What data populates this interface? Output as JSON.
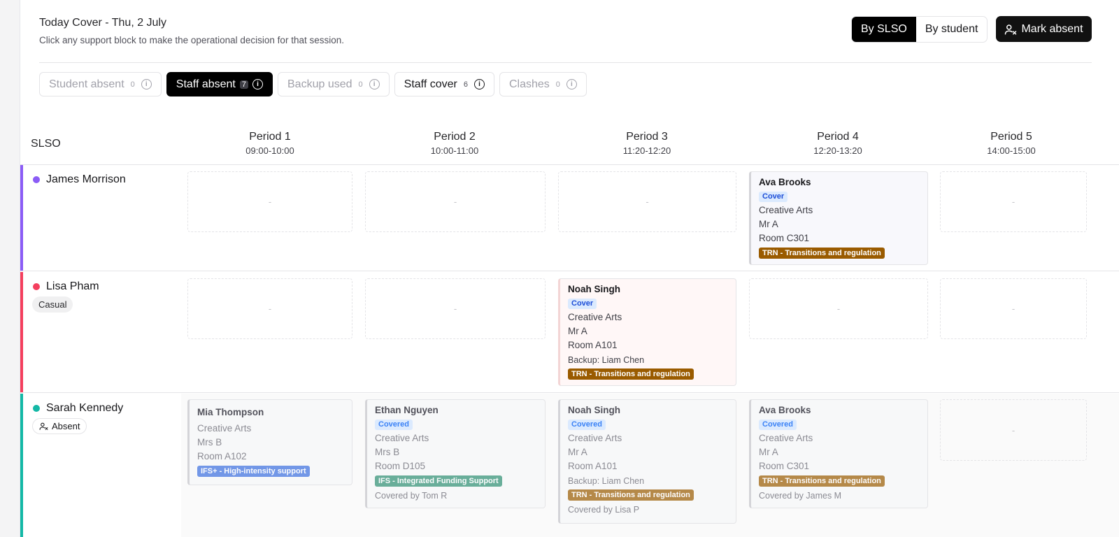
{
  "header": {
    "title": "Today Cover - Thu, 2 July",
    "subtitle": "Click any support block to make the operational decision for that session."
  },
  "view_toggle": {
    "by_slso": "By SLSO",
    "by_student": "By student",
    "active": "By SLSO"
  },
  "mark_absent_label": "Mark absent",
  "filters": [
    {
      "label": "Student absent",
      "count": "0",
      "state": "muted"
    },
    {
      "label": "Staff absent",
      "count": "7",
      "state": "active"
    },
    {
      "label": "Backup used",
      "count": "0",
      "state": "muted"
    },
    {
      "label": "Staff cover",
      "count": "6",
      "state": "strong"
    },
    {
      "label": "Clashes",
      "count": "0",
      "state": "muted"
    }
  ],
  "grid": {
    "slso_header": "SLSO",
    "periods": [
      {
        "name": "Period 1",
        "time": "09:00-10:00"
      },
      {
        "name": "Period 2",
        "time": "10:00-11:00"
      },
      {
        "name": "Period 3",
        "time": "11:20-12:20"
      },
      {
        "name": "Period 4",
        "time": "12:20-13:20"
      },
      {
        "name": "Period 5",
        "time": "14:00-15:00"
      }
    ],
    "empty_mark": "-",
    "rows": [
      {
        "name": "James Morrison",
        "color": "#8b5cf6",
        "tag": "",
        "cells": [
          null,
          null,
          null,
          {
            "student": "Ava Brooks",
            "status": "Cover",
            "subject": "Creative Arts",
            "teacher": "Mr A",
            "room": "Room C301",
            "backup": "",
            "support": "TRN - Transitions and regulation",
            "support_color": "#9a5b00",
            "covered_by": ""
          },
          null
        ]
      },
      {
        "name": "Lisa Pham",
        "color": "#f43f5e",
        "tag": "Casual",
        "cells": [
          null,
          null,
          {
            "student": "Noah Singh",
            "status": "Cover",
            "subject": "Creative Arts",
            "teacher": "Mr A",
            "room": "Room A101",
            "backup": "Backup: Liam Chen",
            "support": "TRN - Transitions and regulation",
            "support_color": "#9a5b00",
            "covered_by": ""
          },
          null,
          null
        ]
      },
      {
        "name": "Sarah Kennedy",
        "color": "#14b8a6",
        "tag": "Absent",
        "cells": [
          {
            "student": "Mia Thompson",
            "status": "",
            "subject": "Creative Arts",
            "teacher": "Mrs B",
            "room": "Room A102",
            "backup": "",
            "support": "IFS+ - High-intensity support",
            "support_color": "#3b6fe0",
            "covered_by": ""
          },
          {
            "student": "Ethan Nguyen",
            "status": "Covered",
            "subject": "Creative Arts",
            "teacher": "Mrs B",
            "room": "Room D105",
            "backup": "",
            "support": "IFS - Integrated Funding Support",
            "support_color": "#2e8f73",
            "covered_by": "Covered by Tom R"
          },
          {
            "student": "Noah Singh",
            "status": "Covered",
            "subject": "Creative Arts",
            "teacher": "Mr A",
            "room": "Room A101",
            "backup": "Backup: Liam Chen",
            "support": "TRN - Transitions and regulation",
            "support_color": "#9a5b00",
            "covered_by": "Covered by Lisa P"
          },
          {
            "student": "Ava Brooks",
            "status": "Covered",
            "subject": "Creative Arts",
            "teacher": "Mr A",
            "room": "Room C301",
            "backup": "",
            "support": "TRN - Transitions and regulation",
            "support_color": "#9a5b00",
            "covered_by": "Covered by James M"
          },
          null
        ]
      }
    ]
  }
}
